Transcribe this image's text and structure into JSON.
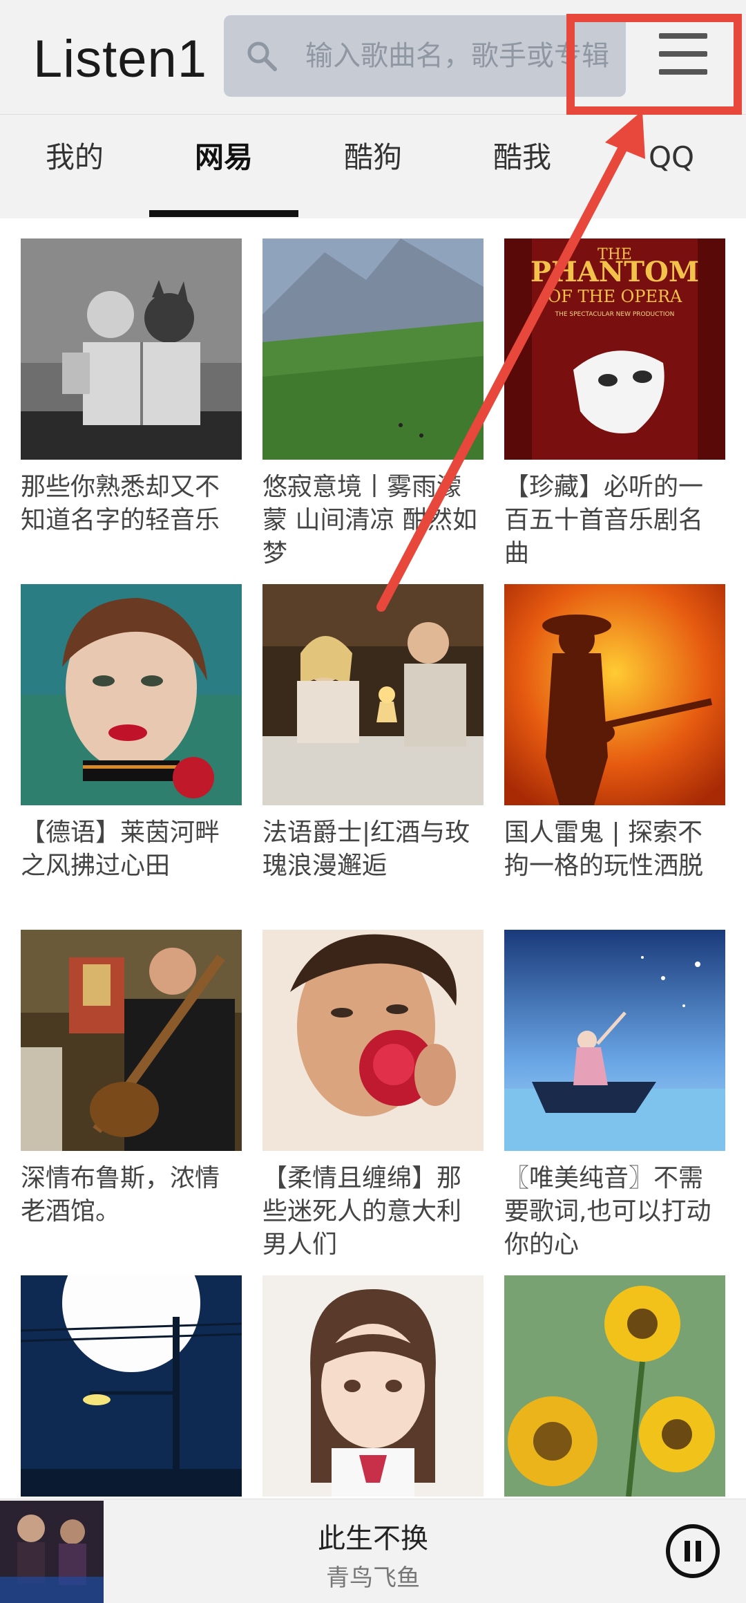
{
  "header": {
    "logo": "Listen1",
    "search_placeholder": "输入歌曲名，歌手或专辑"
  },
  "tabs": [
    "我的",
    "网易",
    "酷狗",
    "酷我",
    "QQ"
  ],
  "active_tab": "网易",
  "playlists": [
    {
      "title": "那些你熟悉却又不知道名字的轻音乐"
    },
    {
      "title": "悠寂意境丨雾雨濛蒙 山间清凉 酣然如梦"
    },
    {
      "title": "【珍藏】必听的一百五十首音乐剧名曲"
    },
    {
      "title": "【德语】莱茵河畔之风拂过心田"
    },
    {
      "title": "法语爵士|红酒与玫瑰浪漫邂逅"
    },
    {
      "title": "国人雷鬼 | 探索不拘一格的玩性洒脱"
    },
    {
      "title": "深情布鲁斯，浓情老酒馆。"
    },
    {
      "title": "【柔情且缠绵】那些迷死人的意大利男人们"
    },
    {
      "title": "〖唯美纯音〗不需要歌词,也可以打动你的心"
    },
    {
      "title": ""
    },
    {
      "title": ""
    },
    {
      "title": ""
    }
  ],
  "cover_text": {
    "phantom_line1": "THE",
    "phantom_line2": "PHANTOM",
    "phantom_line3": "OF THE OPERA",
    "phantom_line4": "THE SPECTACULAR NEW PRODUCTION"
  },
  "player": {
    "song": "此生不换",
    "artist": "青鸟飞鱼"
  },
  "colors": {
    "annotation": "#e8473b",
    "header_bg": "#f2f2f2",
    "search_bg": "#c7ccd4"
  }
}
